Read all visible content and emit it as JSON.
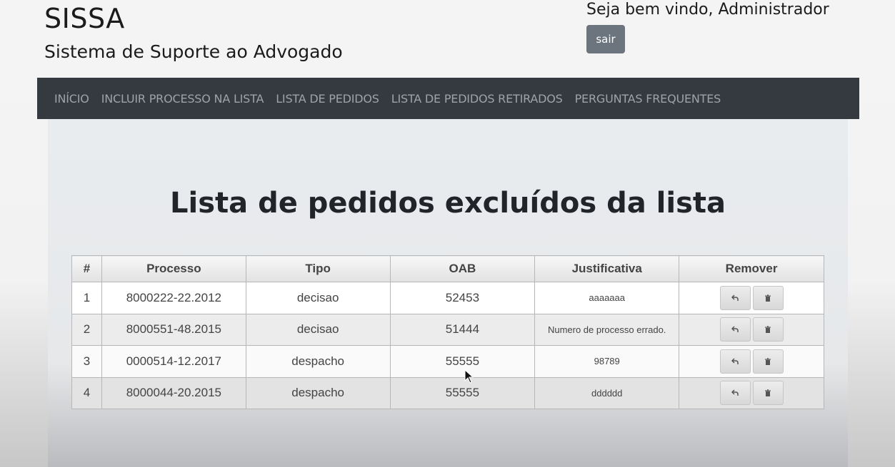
{
  "header": {
    "app_title": "SISSA",
    "app_subtitle": "Sistema de Suporte ao Advogado",
    "welcome": "Seja bem vindo, Administrador",
    "logout_label": "sair"
  },
  "nav": {
    "items": [
      "INÍCIO",
      "INCLUIR PROCESSO NA LISTA",
      "LISTA DE PEDIDOS",
      "LISTA DE PEDIDOS RETIRADOS",
      "PERGUNTAS FREQUENTES"
    ]
  },
  "main": {
    "title": "Lista de pedidos excluídos da lista",
    "table": {
      "headers": [
        "#",
        "Processo",
        "Tipo",
        "OAB",
        "Justificativa",
        "Remover"
      ],
      "rows": [
        {
          "num": "1",
          "processo": "8000222-22.2012",
          "tipo": "decisao",
          "oab": "52453",
          "justificativa": "aaaaaaa"
        },
        {
          "num": "2",
          "processo": "8000551-48.2015",
          "tipo": "decisao",
          "oab": "51444",
          "justificativa": "Numero de processo errado."
        },
        {
          "num": "3",
          "processo": "0000514-12.2017",
          "tipo": "despacho",
          "oab": "55555",
          "justificativa": "98789"
        },
        {
          "num": "4",
          "processo": "8000044-20.2015",
          "tipo": "despacho",
          "oab": "55555",
          "justificativa": "dddddd"
        }
      ],
      "row_actions": [
        "undo-icon",
        "trash-icon"
      ]
    }
  },
  "colors": {
    "navbar_bg": "#343a40",
    "nav_text": "#9ea3a8",
    "logout_bg": "#6c757d",
    "content_bg": "#e9ecef"
  }
}
